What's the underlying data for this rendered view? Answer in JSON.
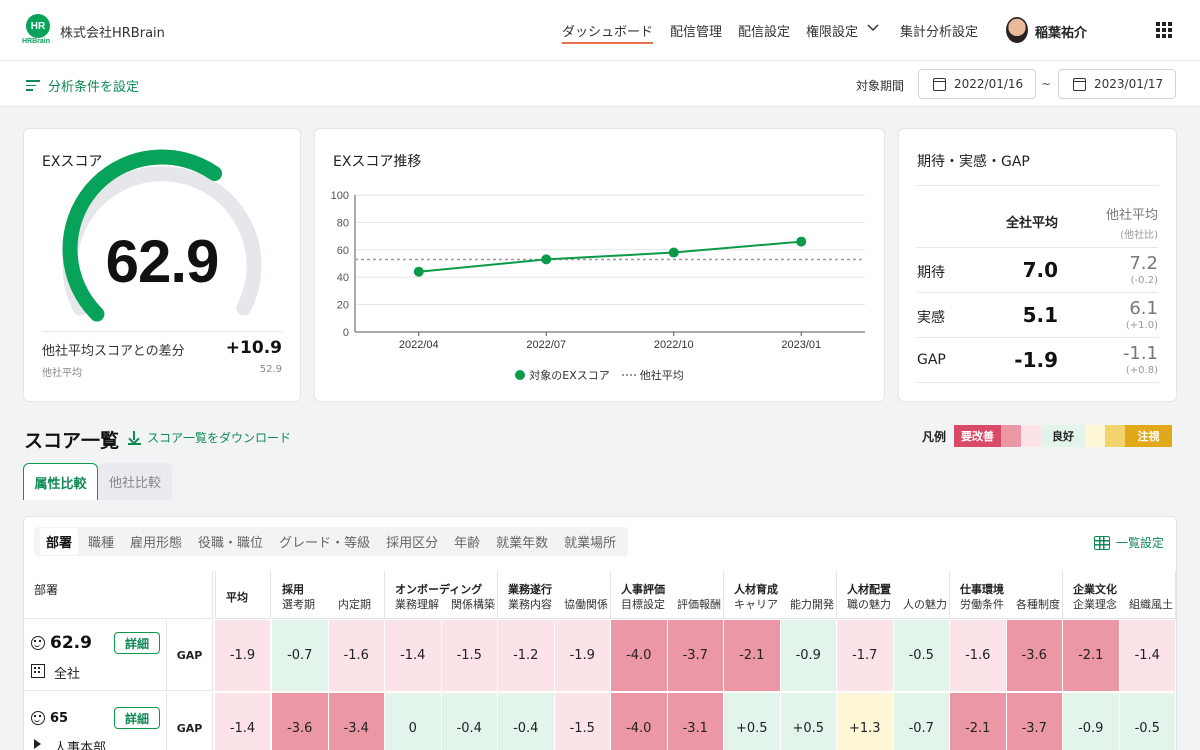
{
  "header": {
    "logo_text": "HR",
    "logo_sub": "HRBrain",
    "company": "株式会社HRBrain",
    "nav": [
      "ダッシュボード",
      "配信管理",
      "配信設定",
      "権限設定",
      "集計分析設定"
    ],
    "user_name": "稲葉祐介"
  },
  "subbar": {
    "filter_label": "分析条件を設定",
    "period_label": "対象期間",
    "start_date": "2022/01/16",
    "tilde": "~",
    "end_date": "2023/01/17"
  },
  "ex_score": {
    "title": "EXスコア",
    "score": "62.9",
    "score_value": 62.9,
    "diff_label": "他社平均スコアとの差分",
    "diff_value": "+10.9",
    "other_label": "他社平均",
    "other_value": "52.9"
  },
  "trend": {
    "title": "EXスコア推移",
    "legend_series": "対象のEXスコア",
    "legend_avg": "他社平均"
  },
  "chart_data": {
    "type": "line",
    "title": "EXスコア推移",
    "x": [
      "2022/04",
      "2022/07",
      "2022/10",
      "2023/01"
    ],
    "series": [
      {
        "name": "対象のEXスコア",
        "values": [
          44,
          53,
          58,
          66
        ]
      },
      {
        "name": "他社平均",
        "values": [
          52.9,
          52.9,
          52.9,
          52.9
        ]
      }
    ],
    "ylim": [
      0,
      100
    ],
    "yticks": [
      0,
      20,
      40,
      60,
      80,
      100
    ],
    "grid": true,
    "legend": "bottom",
    "colors": {
      "series": "#0a9a4a",
      "average": "#999999"
    }
  },
  "gap_card": {
    "title": "期待・実感・GAP",
    "col_company": "全社平均",
    "col_other": "他社平均",
    "col_other_sub": "(他社比)",
    "rows": [
      {
        "label": "期待",
        "value": "7.0",
        "other": "7.2",
        "diff": "(-0.2)"
      },
      {
        "label": "実感",
        "value": "5.1",
        "other": "6.1",
        "diff": "(+1.0)"
      },
      {
        "label": "GAP",
        "value": "-1.9",
        "other": "-1.1",
        "diff": "(+0.8)"
      }
    ]
  },
  "score_list": {
    "title": "スコア一覧",
    "download_label": "スコア一覧をダウンロード",
    "legend_title": "凡例",
    "legend_bad": "要改善",
    "legend_good": "良好",
    "legend_warn": "注視",
    "tabs": [
      "属性比較",
      "他社比較"
    ],
    "attr_tabs": [
      "部署",
      "職種",
      "雇用形態",
      "役職・職位",
      "グレード・等級",
      "採用区分",
      "年齢",
      "就業年数",
      "就業場所"
    ],
    "settings_label": "一覧設定",
    "col_dept": "部署",
    "col_avg": "平均",
    "categories": [
      {
        "name": "採用",
        "subs": [
          "選考期",
          "内定期"
        ]
      },
      {
        "name": "オンボーディング",
        "subs": [
          "業務理解",
          "関係構築"
        ]
      },
      {
        "name": "業務遂行",
        "subs": [
          "業務内容",
          "協働関係"
        ]
      },
      {
        "name": "人事評価",
        "subs": [
          "目標設定",
          "評価報酬"
        ]
      },
      {
        "name": "人材育成",
        "subs": [
          "キャリア",
          "能力開発"
        ]
      },
      {
        "name": "人材配置",
        "subs": [
          "職の魅力",
          "人の魅力"
        ]
      },
      {
        "name": "仕事環境",
        "subs": [
          "労働条件",
          "各種制度"
        ]
      },
      {
        "name": "企業文化",
        "subs": [
          "企業理念",
          "組織風土"
        ]
      }
    ],
    "rows": [
      {
        "score": "62.9",
        "name": "全社",
        "detail": "詳細",
        "gap": "GAP",
        "cells": [
          "-1.9",
          "-0.7",
          "-1.6",
          "-1.4",
          "-1.5",
          "-1.2",
          "-1.9",
          "-4.0",
          "-3.7",
          "-2.1",
          "-0.9",
          "-1.7",
          "-0.5",
          "-1.6",
          "-3.6",
          "-2.1",
          "-1.4"
        ],
        "levels": [
          "lb",
          "lg",
          "lb",
          "lb",
          "lb",
          "lb",
          "lb",
          "b",
          "b",
          "b",
          "lg",
          "lb",
          "lg",
          "lb",
          "b",
          "b",
          "lb"
        ]
      },
      {
        "score": "65",
        "name": "人事本部",
        "detail": "詳細",
        "gap": "GAP",
        "cells": [
          "-1.4",
          "-3.6",
          "-3.4",
          "0",
          "-0.4",
          "-0.4",
          "-1.5",
          "-4.0",
          "-3.1",
          "+0.5",
          "+0.5",
          "+1.3",
          "-0.7",
          "-2.1",
          "-3.7",
          "-0.9",
          "-0.5"
        ],
        "levels": [
          "lb",
          "b",
          "b",
          "lg",
          "lg",
          "lg",
          "lb",
          "b",
          "b",
          "lg",
          "lg",
          "ly",
          "lg",
          "b",
          "b",
          "lg",
          "lg"
        ]
      }
    ]
  }
}
